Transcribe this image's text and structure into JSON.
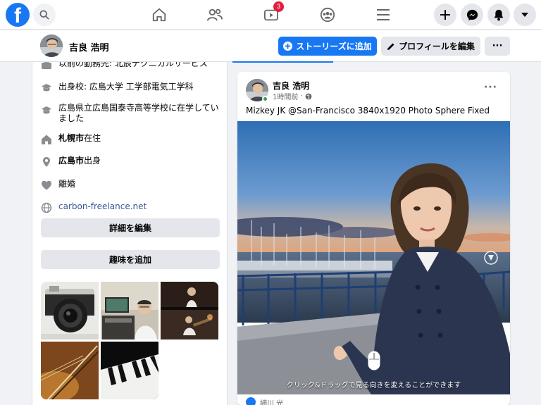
{
  "nav": {
    "logo_letter": "f",
    "icons": [
      "search-icon",
      "home-icon",
      "friends-icon",
      "watch-icon",
      "groups-icon",
      "menu-icon",
      "plus-icon",
      "messenger-icon",
      "notifications-icon",
      "account-dropdown-icon"
    ],
    "watch_badge": "3"
  },
  "profile": {
    "name": "吉良 浩明",
    "add_story_label": "ストーリーズに追加",
    "edit_profile_label": "プロフィールを編集",
    "more_label": "···"
  },
  "intro": {
    "work_partial": "以前の勤務先: 北辰テクニカルサービス",
    "education": "出身校: 広島大学 工学部電気工学科",
    "school": "広島県立広島国泰寺高等学校に在学していました",
    "lives_city": "札幌市",
    "lives_suffix": "在住",
    "from_city": "広島市",
    "from_suffix": "出身",
    "relationship": "離婚",
    "website": "carbon-freelance.net",
    "edit_details_label": "詳細を編集",
    "add_hobbies_label": "趣味を追加"
  },
  "post": {
    "author": "吉良 浩明",
    "time": "1時間前",
    "separator": "·",
    "text": "Mizkey JK @San-Francisco 3840x1920 Photo Sphere Fixed",
    "pano_hint": "クリック&ドラッグで見る向きを変えることができます",
    "options_label": "···",
    "comment_partial": "細川 光"
  },
  "colors": {
    "brand": "#1877f2",
    "badge": "#e41e3f",
    "online": "#31a24c",
    "link": "#385898"
  }
}
